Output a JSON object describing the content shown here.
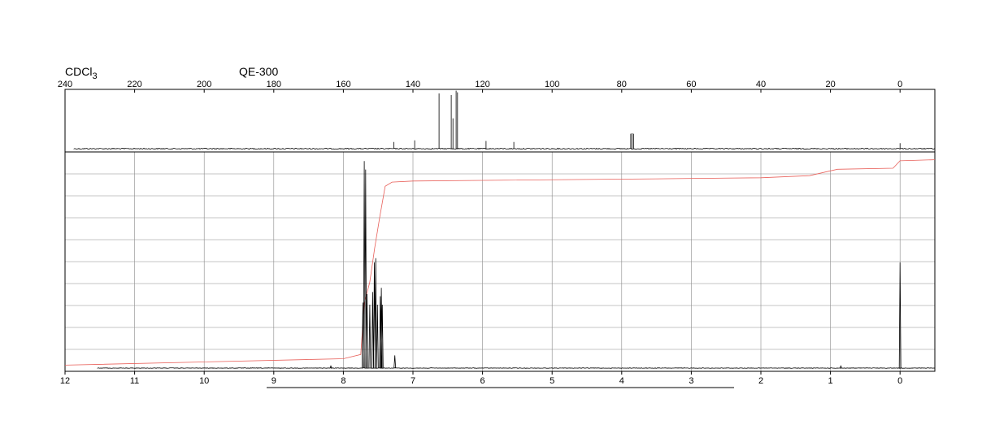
{
  "header": {
    "solvent": "CDCl",
    "solvent_subscript": "3",
    "instrument": "QE-300"
  },
  "colors": {
    "trace": "#000000",
    "integral": "#e8605a",
    "grid": "#8a8a8a",
    "frame": "#000000"
  },
  "chart_data": [
    {
      "type": "line",
      "xlabel": "",
      "ylabel": "",
      "xlim": [
        240,
        -10
      ],
      "reversed_x": true,
      "ticks": [
        240,
        220,
        200,
        180,
        160,
        140,
        120,
        100,
        80,
        60,
        40,
        20,
        0
      ],
      "tick_labels": [
        "240",
        "220",
        "200",
        "180",
        "160",
        "140",
        "120",
        "100",
        "80",
        "60",
        "40",
        "20",
        "0"
      ],
      "peaks": [
        {
          "x": 145.5,
          "height": 0.12
        },
        {
          "x": 139.5,
          "height": 0.15
        },
        {
          "x": 132.5,
          "height": 1.0
        },
        {
          "x": 129.0,
          "height": 0.97
        },
        {
          "x": 128.5,
          "height": 0.55
        },
        {
          "x": 127.6,
          "height": 1.05
        },
        {
          "x": 127.2,
          "height": 1.02
        },
        {
          "x": 119.0,
          "height": 0.14
        },
        {
          "x": 111.0,
          "height": 0.12
        },
        {
          "x": 77.4,
          "height": 0.27
        },
        {
          "x": 77.0,
          "height": 0.28
        },
        {
          "x": 76.6,
          "height": 0.27
        },
        {
          "x": 0.0,
          "height": 0.1
        }
      ]
    },
    {
      "type": "line",
      "xlabel": "",
      "ylabel": "",
      "xlim": [
        12,
        -0.5
      ],
      "reversed_x": true,
      "grid": true,
      "ticks": [
        12,
        11,
        10,
        9,
        8,
        7,
        6,
        5,
        4,
        3,
        2,
        1,
        0
      ],
      "tick_labels": [
        "12",
        "11",
        "10",
        "9",
        "8",
        "7",
        "6",
        "5",
        "4",
        "3",
        "2",
        "1",
        "0"
      ],
      "peaks": [
        {
          "x": 8.18,
          "height": 0.01
        },
        {
          "x": 7.72,
          "height": 0.31
        },
        {
          "x": 7.7,
          "height": 0.98
        },
        {
          "x": 7.68,
          "height": 0.94
        },
        {
          "x": 7.66,
          "height": 0.35
        },
        {
          "x": 7.62,
          "height": 0.3
        },
        {
          "x": 7.58,
          "height": 0.36
        },
        {
          "x": 7.555,
          "height": 0.5
        },
        {
          "x": 7.535,
          "height": 0.52
        },
        {
          "x": 7.51,
          "height": 0.3
        },
        {
          "x": 7.47,
          "height": 0.34
        },
        {
          "x": 7.455,
          "height": 0.38
        },
        {
          "x": 7.44,
          "height": 0.3
        },
        {
          "x": 7.26,
          "height": 0.06
        },
        {
          "x": 0.85,
          "height": 0.01
        },
        {
          "x": 0.0,
          "height": 0.5
        }
      ],
      "integral": [
        [
          12.0,
          0.01
        ],
        [
          8.0,
          0.04
        ],
        [
          7.75,
          0.06
        ],
        [
          7.7,
          0.3
        ],
        [
          7.62,
          0.4
        ],
        [
          7.55,
          0.56
        ],
        [
          7.48,
          0.7
        ],
        [
          7.4,
          0.85
        ],
        [
          7.3,
          0.87
        ],
        [
          7.0,
          0.875
        ],
        [
          6.0,
          0.878
        ],
        [
          3.5,
          0.885
        ],
        [
          2.0,
          0.89
        ],
        [
          1.3,
          0.9
        ],
        [
          0.9,
          0.93
        ],
        [
          0.1,
          0.935
        ],
        [
          0.0,
          0.97
        ],
        [
          -0.5,
          0.975
        ]
      ]
    }
  ]
}
